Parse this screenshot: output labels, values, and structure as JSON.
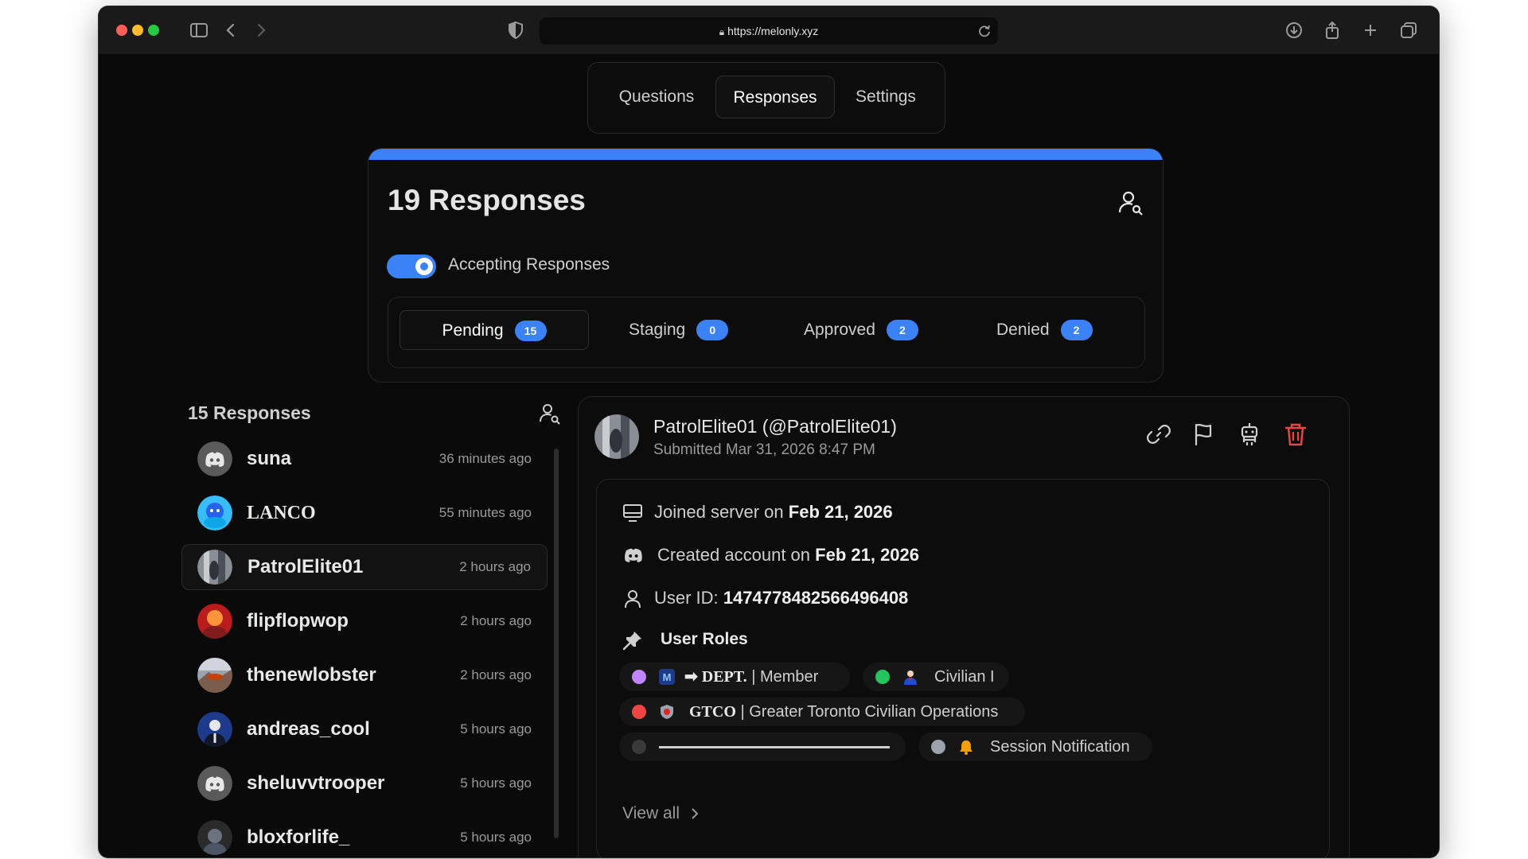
{
  "browser": {
    "url": "https://melonly.xyz",
    "traffic_colors": [
      "#ff5f57",
      "#febc2e",
      "#28c840"
    ]
  },
  "nav_tabs": [
    {
      "label": "Questions",
      "active": false
    },
    {
      "label": "Responses",
      "active": true
    },
    {
      "label": "Settings",
      "active": false
    }
  ],
  "summary": {
    "title": "19 Responses",
    "accent": "#3b82f6",
    "toggle_label": "Accepting Responses",
    "toggle_on": true,
    "statuses": [
      {
        "label": "Pending",
        "count": "15",
        "active": true
      },
      {
        "label": "Staging",
        "count": "0",
        "active": false
      },
      {
        "label": "Approved",
        "count": "2",
        "active": false
      },
      {
        "label": "Denied",
        "count": "2",
        "active": false
      }
    ]
  },
  "list": {
    "title": "15 Responses",
    "items": [
      {
        "name": "suna",
        "time": "36 minutes ago",
        "avatar": "discord-default"
      },
      {
        "name": "LANCO",
        "time": "55 minutes ago",
        "avatar": "blue-cartoon"
      },
      {
        "name": "PatrolElite01",
        "time": "2 hours ago",
        "avatar": "gray-photo",
        "active": true
      },
      {
        "name": "flipflopwop",
        "time": "2 hours ago",
        "avatar": "red-orange"
      },
      {
        "name": "thenewlobster",
        "time": "2 hours ago",
        "avatar": "mountain-photo"
      },
      {
        "name": "andreas_cool",
        "time": "5 hours ago",
        "avatar": "blue-suit"
      },
      {
        "name": "sheluvvtrooper",
        "time": "5 hours ago",
        "avatar": "discord-default"
      },
      {
        "name": "bloxforlife_",
        "time": "5 hours ago",
        "avatar": "dark-photo"
      }
    ]
  },
  "detail": {
    "name": "PatrolElite01 (@PatrolElite01)",
    "submitted": "Submitted Mar 31, 2026 8:47 PM",
    "joined_prefix": "Joined server on",
    "joined_date": "Feb 21, 2026",
    "created_prefix": "Created account on",
    "created_date": "Feb 21, 2026",
    "userid_prefix": "User ID:",
    "userid": "1474778482566496408",
    "roles_title": "User Roles",
    "roles": [
      {
        "dot": "#c084fc",
        "bold": "➡ DEPT.",
        "text": "| Member",
        "icon": "m-icon"
      },
      {
        "dot": "#22c55e",
        "bold": "",
        "text": "Civilian I",
        "icon": "person-icon"
      },
      {
        "dot": "#ef4444",
        "bold": "GTCO",
        "text": "| Greater Toronto Civilian Operations",
        "icon": "shield-icon"
      },
      {
        "dot": "#3a3a3a",
        "bold": "",
        "text": "",
        "icon": "line"
      },
      {
        "dot": "#9ca3af",
        "bold": "",
        "text": "Session Notification",
        "icon": "bell-icon"
      }
    ],
    "view_all": "View all"
  }
}
